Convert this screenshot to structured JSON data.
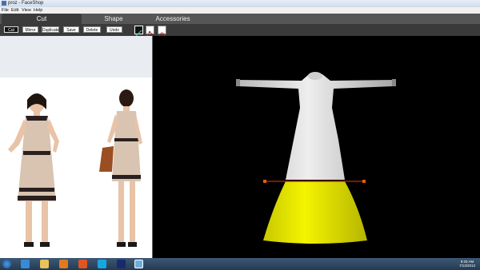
{
  "window": {
    "title": "proz - FaceShop"
  },
  "menu": [
    "File",
    "Edit",
    "View",
    "Help"
  ],
  "tabs": [
    {
      "label": "Cut",
      "active": true
    },
    {
      "label": "Shape",
      "active": false
    },
    {
      "label": "Accessories",
      "active": false
    }
  ],
  "toolbar": {
    "buttons": [
      "Cut",
      "Mirror",
      "Duplicate",
      "Save",
      "Delete",
      "Undo"
    ],
    "selected": "Cut",
    "icons": [
      "pen-line-icon",
      "node-edit-icon",
      "curve-icon"
    ]
  },
  "colors": {
    "cut_region": "#e6e600",
    "cut_line": "#cc2200",
    "garment": "#d9d9d9",
    "dress_reference": "#d8c4b0",
    "dress_trim": "#2a2020"
  },
  "taskbar": {
    "apps": [
      "windows-start-icon",
      "ie-icon",
      "folder-icon",
      "media-player-icon",
      "firefox-icon",
      "skype-icon",
      "photoshop-icon",
      "faceshop-icon"
    ],
    "time": "9:25 AM",
    "date": "7/13/2013"
  }
}
